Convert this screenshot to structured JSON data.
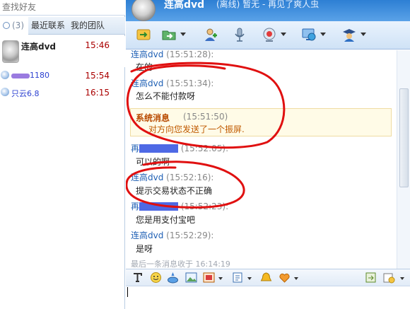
{
  "search": {
    "placeholder": "查找好友"
  },
  "tabs": [
    {
      "label": "(3)"
    },
    {
      "label": "最近联系"
    },
    {
      "label": "我的团队"
    }
  ],
  "contacts": [
    {
      "name": "连高dvd",
      "time": "15:46"
    },
    {
      "name": "1180",
      "time": "15:54"
    },
    {
      "name": "只云6.8",
      "time": "16:15"
    }
  ],
  "header": {
    "title": "连高dvd",
    "subtitle": "(离线) 暂无 - 再见了爽人虫"
  },
  "toolbar": {
    "icons": [
      "send-file-icon",
      "folder-icon",
      "add-contact-icon",
      "microphone-icon",
      "webcam-icon",
      "screen-share-icon",
      "group-icon"
    ]
  },
  "messages": [
    {
      "who": "连高dvd",
      "time": "(15:51:28):",
      "body": "在的"
    },
    {
      "who": "连高dvd",
      "time": "(15:51:34):",
      "body": "怎么不能付款呀"
    },
    {
      "who": "再",
      "time": "(15:52:05):",
      "body": "可以的啊"
    },
    {
      "who": "连高dvd",
      "time": "(15:52:16):",
      "body": "提示交易状态不正确"
    },
    {
      "who": "再",
      "time": "(15:52:23):",
      "body": "您是用支付宝吧"
    },
    {
      "who": "连高dvd",
      "time": "(15:52:29):",
      "body": "是呀"
    }
  ],
  "system_message": {
    "title": "系统消息",
    "time": "(15:51:50)",
    "body": "对方向您发送了一个振屏."
  },
  "footnote": "最后一条消息收于 16:14:19",
  "input": {
    "value": ""
  },
  "colors": {
    "accent": "#2d7fd4",
    "sys_bg": "#fffbe7",
    "ink": "#e01010"
  }
}
